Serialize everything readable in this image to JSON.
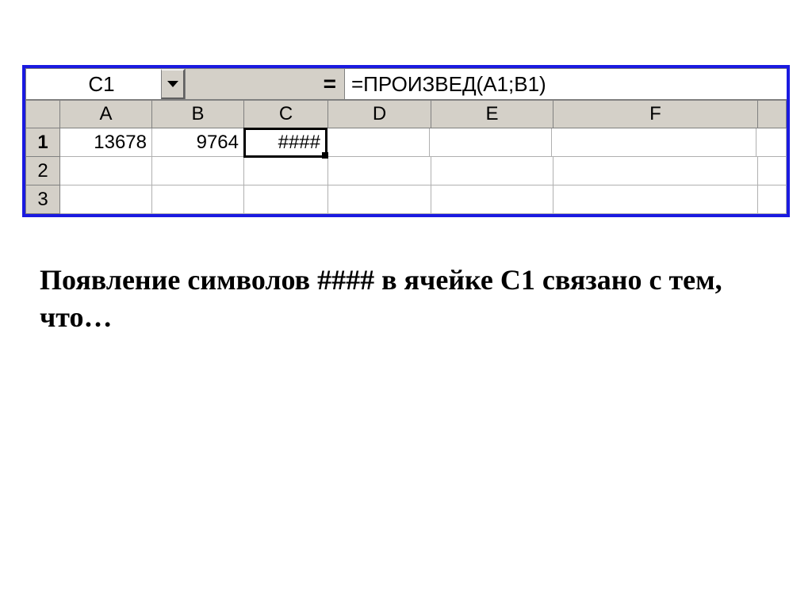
{
  "formula_bar": {
    "cell_ref": "C1",
    "eq": "=",
    "formula": "=ПРОИЗВЕД(A1;B1)"
  },
  "columns": [
    "A",
    "B",
    "C",
    "D",
    "E",
    "F"
  ],
  "rows": [
    "1",
    "2",
    "3"
  ],
  "cells": {
    "A1": "13678",
    "B1": "9764",
    "C1": "####"
  },
  "question": "Появление символов #### в ячейке С1 связано с тем, что…"
}
